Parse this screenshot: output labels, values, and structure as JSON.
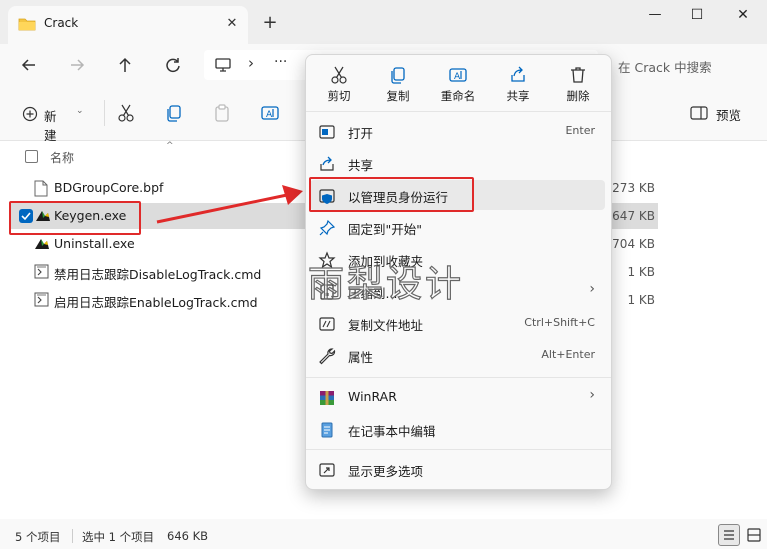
{
  "window": {
    "tab_title": "Crack",
    "tab_close": "✕",
    "new_tab": "+",
    "minimize": "—",
    "maximize": "☐",
    "close": "✕"
  },
  "address": {
    "more": "···",
    "chevron": "›",
    "search_placeholder": "在 Crack 中搜索"
  },
  "toolbar": {
    "new_label": "新建",
    "preview_label": "预览"
  },
  "file_list": {
    "header_name": "名称",
    "sort_indicator": "^",
    "rows": [
      {
        "name": "BDGroupCore.bpf",
        "size": "273 KB",
        "icon": "file-icon",
        "selected": false
      },
      {
        "name": "Keygen.exe",
        "size": "647 KB",
        "icon": "keygen-app-icon",
        "selected": true
      },
      {
        "name": "Uninstall.exe",
        "size": "704 KB",
        "icon": "uninstall-app-icon",
        "selected": false
      },
      {
        "name": "禁用日志跟踪DisableLogTrack.cmd",
        "size": "1 KB",
        "icon": "cmd-file-icon",
        "selected": false
      },
      {
        "name": "启用日志跟踪EnableLogTrack.cmd",
        "size": "1 KB",
        "icon": "cmd-file-icon",
        "selected": false
      }
    ]
  },
  "status": {
    "count": "5 个项目",
    "selected": "选中 1 个项目",
    "size": "646 KB"
  },
  "context_menu": {
    "quick_actions": [
      {
        "label": "剪切",
        "icon": "cut-icon"
      },
      {
        "label": "复制",
        "icon": "copy-icon"
      },
      {
        "label": "重命名",
        "icon": "rename-icon"
      },
      {
        "label": "共享",
        "icon": "share-icon"
      },
      {
        "label": "删除",
        "icon": "delete-icon"
      }
    ],
    "items": [
      {
        "label": "打开",
        "shortcut": "Enter",
        "icon": "open-icon"
      },
      {
        "label": "共享",
        "shortcut": "",
        "icon": "share-icon"
      },
      {
        "label": "以管理员身份运行",
        "shortcut": "",
        "icon": "admin-shield-icon"
      },
      {
        "label": "固定到\"开始\"",
        "shortcut": "",
        "icon": "pin-icon"
      },
      {
        "label": "添加到收藏夹",
        "shortcut": "",
        "icon": "star-icon"
      },
      {
        "label": "压缩到...",
        "shortcut": "",
        "icon": "zip-icon",
        "arrow": "›"
      },
      {
        "label": "复制文件地址",
        "shortcut": "Ctrl+Shift+C",
        "icon": "copy-path-icon"
      },
      {
        "label": "属性",
        "shortcut": "Alt+Enter",
        "icon": "wrench-icon"
      },
      {
        "label": "WinRAR",
        "shortcut": "",
        "icon": "winrar-icon",
        "arrow": "›"
      },
      {
        "label": "在记事本中编辑",
        "shortcut": "",
        "icon": "notepad-icon"
      },
      {
        "label": "显示更多选项",
        "shortcut": "",
        "icon": "more-options-icon"
      }
    ]
  },
  "watermark": "雨梨设计",
  "colors": {
    "accent": "#0067c0",
    "annotation_red": "#e02a2a",
    "selected_row": "#dcdcdc"
  }
}
